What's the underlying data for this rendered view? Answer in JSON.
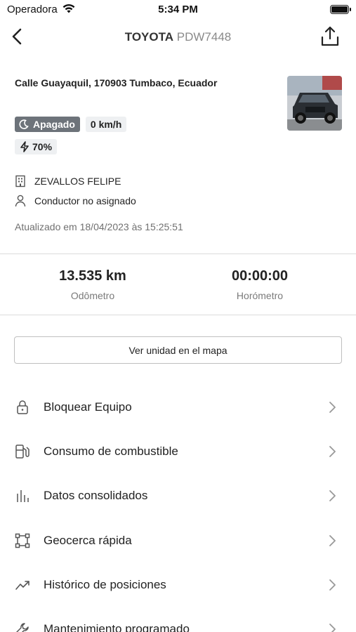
{
  "status_bar": {
    "carrier": "Operadora",
    "time": "5:34 PM"
  },
  "header": {
    "brand": "TOYOTA",
    "plate": "PDW7448"
  },
  "vehicle": {
    "address": "Calle Guayaquil, 170903 Tumbaco, Ecuador",
    "status_label": "Apagado",
    "speed": "0 km/h",
    "battery": "70%",
    "company": "ZEVALLOS FELIPE",
    "driver": "Conductor no asignado",
    "updated": "Atualizado em 18/04/2023 às 15:25:51"
  },
  "stats": {
    "odometer_value": "13.535 km",
    "odometer_label": "Odômetro",
    "hourmeter_value": "00:00:00",
    "hourmeter_label": "Horómetro"
  },
  "map_button": "Ver unidad en el mapa",
  "menu": [
    {
      "label": "Bloquear Equipo",
      "icon": "lock-icon"
    },
    {
      "label": "Consumo de combustible",
      "icon": "fuel-icon"
    },
    {
      "label": "Datos consolidados",
      "icon": "bar-chart-icon"
    },
    {
      "label": "Geocerca rápida",
      "icon": "geofence-icon"
    },
    {
      "label": "Histórico de posiciones",
      "icon": "trend-icon"
    },
    {
      "label": "Mantenimiento programado",
      "icon": "wrench-icon"
    }
  ],
  "colors": {
    "badge_off": "#6d737a",
    "badge_light": "#eef0f2",
    "divider": "#dcdcdc",
    "muted_text": "#707070"
  }
}
